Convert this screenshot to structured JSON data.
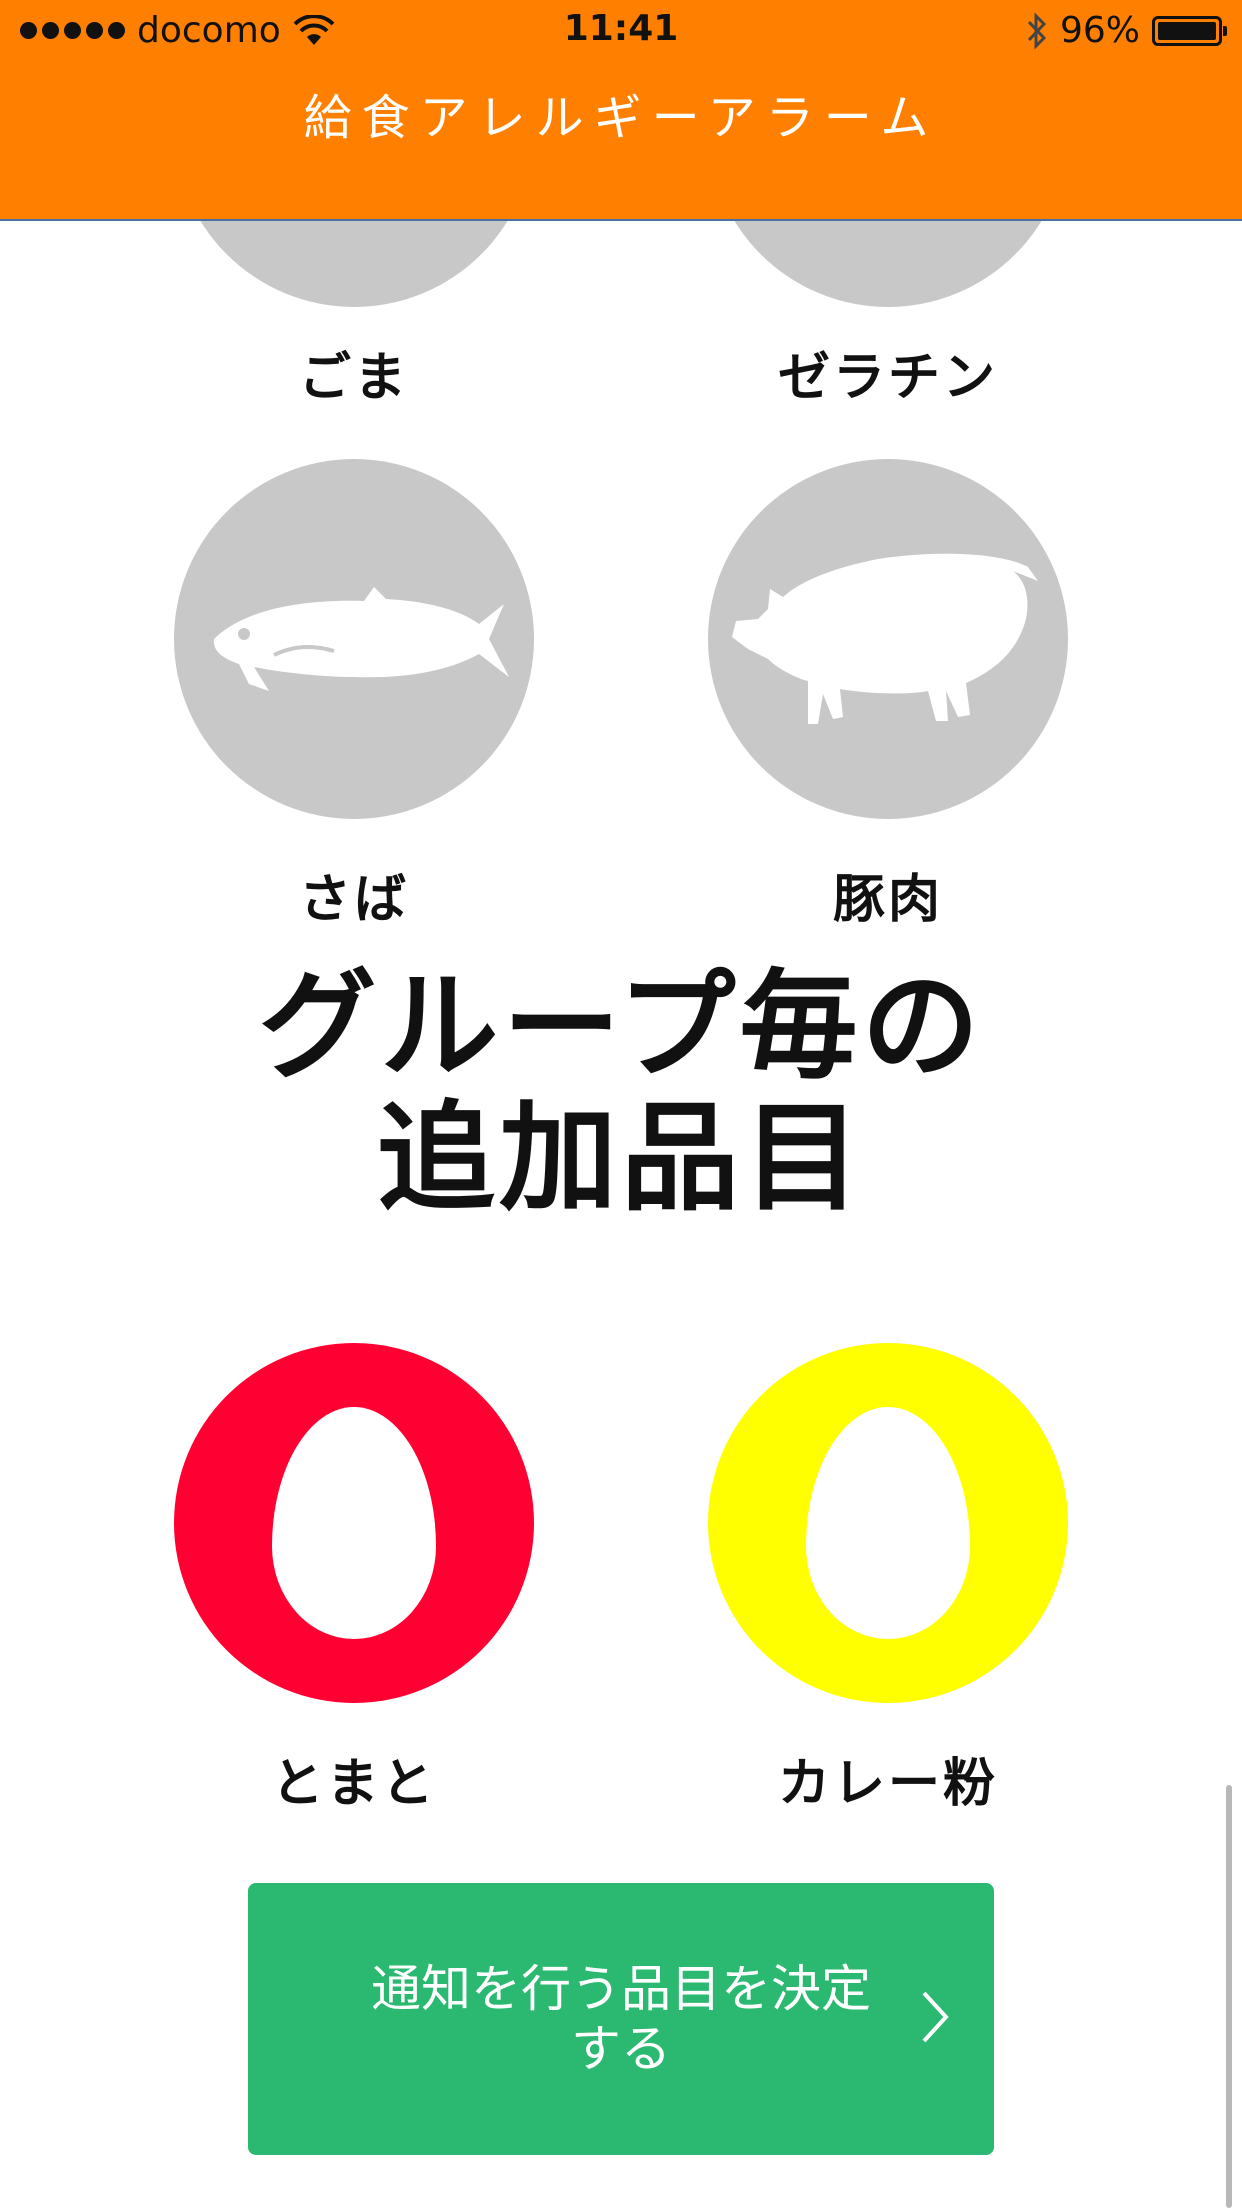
{
  "status_bar": {
    "carrier": "docomo",
    "time": "11:41",
    "battery": "96%"
  },
  "header": {
    "title": "給食アレルギーアラーム"
  },
  "items_top": [
    {
      "label": "ごま",
      "icon": "sesame-icon"
    },
    {
      "label": "ゼラチン",
      "icon": "gelatin-icon"
    }
  ],
  "items_mid": [
    {
      "label": "さば",
      "icon": "mackerel-icon"
    },
    {
      "label": "豚肉",
      "icon": "pig-icon"
    }
  ],
  "section": {
    "title_line1": "グループ毎の",
    "title_line2": "追加品目"
  },
  "group_items": [
    {
      "label": "とまと",
      "color": "#ff0033",
      "icon": "egg-icon"
    },
    {
      "label": "カレー粉",
      "color": "#ffff00",
      "icon": "egg-icon"
    }
  ],
  "submit": {
    "label_line1": "通知を行う品目を決定",
    "label_line2": "する"
  },
  "colors": {
    "header": "#ff8000",
    "inactive": "#c8c8c8",
    "button": "#2bb870"
  }
}
